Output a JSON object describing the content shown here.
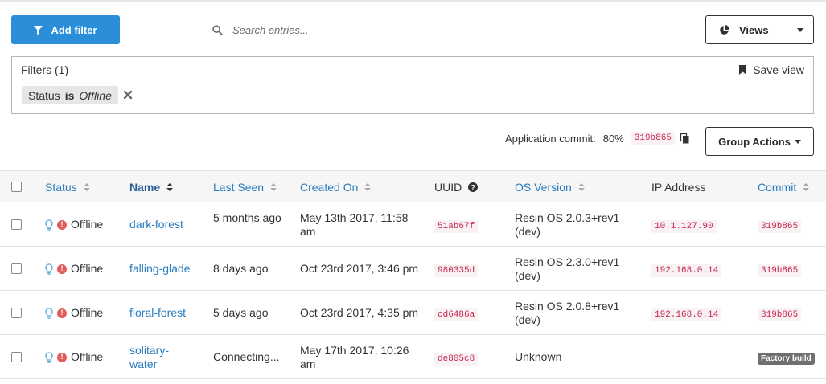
{
  "toolbar": {
    "add_filter_label": "Add filter",
    "search_placeholder": "Search entries...",
    "views_label": "Views"
  },
  "filters": {
    "title": "Filters (1)",
    "save_view_label": "Save view",
    "chip": {
      "field": "Status",
      "operator": "is",
      "value": "Offline"
    }
  },
  "commit_bar": {
    "label": "Application commit:",
    "percent": "80%",
    "commit": "319b865",
    "group_actions_label": "Group Actions"
  },
  "table": {
    "headers": {
      "status": "Status",
      "name": "Name",
      "last_seen": "Last Seen",
      "created_on": "Created On",
      "uuid": "UUID",
      "os_version": "OS Version",
      "ip_address": "IP Address",
      "commit": "Commit"
    },
    "rows": [
      {
        "status": "Offline",
        "name": "dark-forest",
        "last_seen": "5 months ago",
        "created_on": "May 13th 2017, 11:58 am",
        "uuid": "51ab67f",
        "os_version": "Resin OS 2.0.3+rev1 (dev)",
        "ip": "10.1.127.90",
        "commit": "319b865",
        "factory_build": ""
      },
      {
        "status": "Offline",
        "name": "falling-glade",
        "last_seen": "8 days ago",
        "created_on": "Oct 23rd 2017, 3:46 pm",
        "uuid": "980335d",
        "os_version": "Resin OS 2.3.0+rev1 (dev)",
        "ip": "192.168.0.14",
        "commit": "319b865",
        "factory_build": ""
      },
      {
        "status": "Offline",
        "name": "floral-forest",
        "last_seen": "5 days ago",
        "created_on": "Oct 23rd 2017, 4:35 pm",
        "uuid": "cd6486a",
        "os_version": "Resin OS 2.0.8+rev1 (dev)",
        "ip": "192.168.0.14",
        "commit": "319b865",
        "factory_build": ""
      },
      {
        "status": "Offline",
        "name": "solitary-water",
        "last_seen": "Connecting...",
        "created_on": "May 17th 2017, 10:26 am",
        "uuid": "de805c8",
        "os_version": "Unknown",
        "ip": "",
        "commit": "",
        "factory_build": "Factory build"
      }
    ]
  },
  "colors": {
    "primary": "#2a8fd8",
    "link": "#2a7bbd",
    "code_text": "#c7254e",
    "code_bg": "#f9f2f4",
    "offline_alert": "#e35c5c",
    "bulb": "#5aa8de"
  },
  "icons": {
    "add_filter": "filter-funnel-icon",
    "search": "search-icon",
    "views": "pie-chart-icon",
    "save_view": "bookmark-icon",
    "remove_filter": "close-icon",
    "copy": "copy-icon",
    "uuid_help": "question-circle-icon",
    "device": "lightbulb-icon",
    "offline": "exclamation-circle-icon"
  }
}
